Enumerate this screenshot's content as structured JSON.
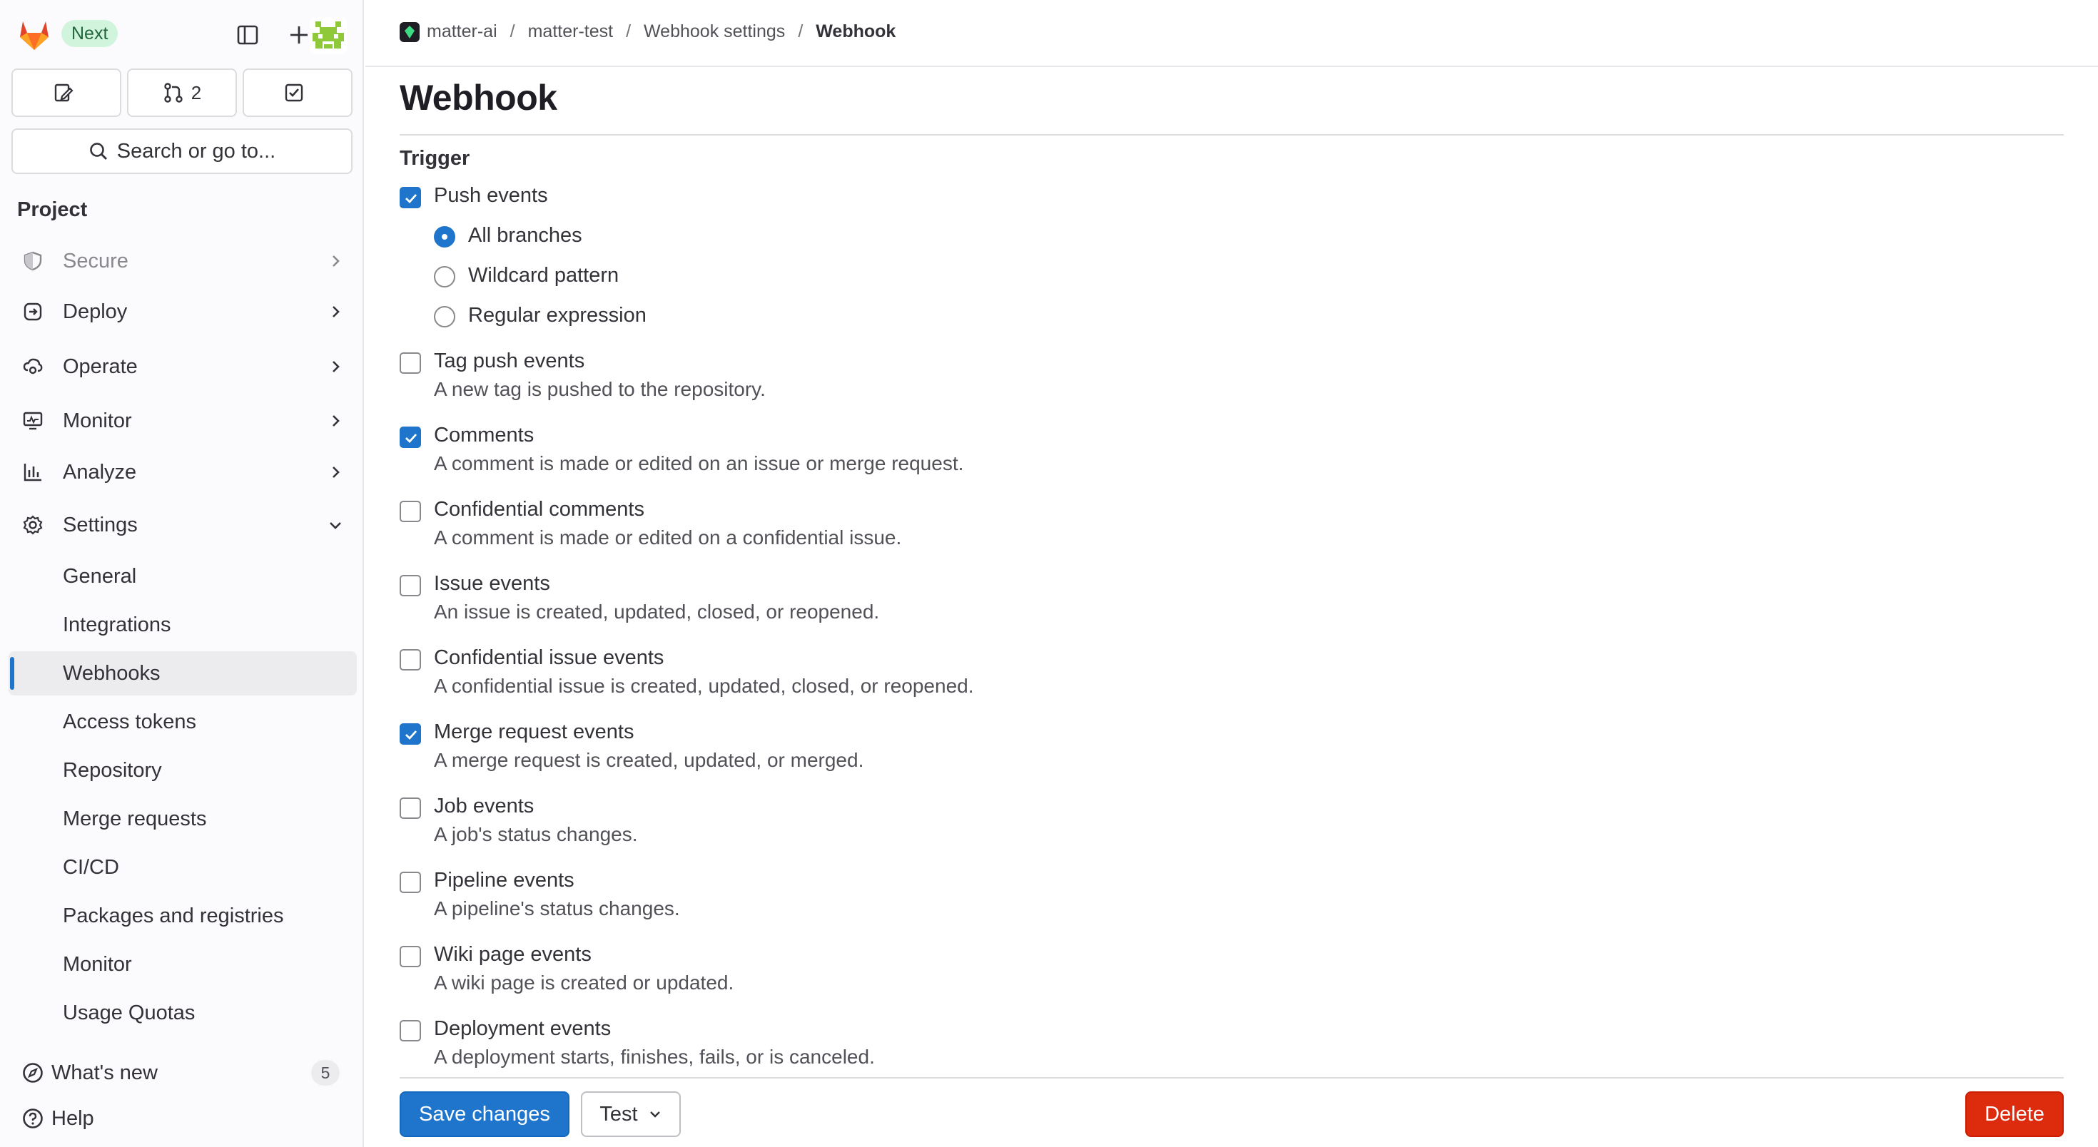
{
  "sidebar": {
    "badge": "Next",
    "counts": {
      "issues": "",
      "merge_requests": "2",
      "todos": ""
    },
    "search_label": "Search or go to...",
    "section_title": "Project",
    "nav": [
      {
        "label": "Secure",
        "icon": "shield-icon"
      },
      {
        "label": "Deploy",
        "icon": "deploy-icon"
      },
      {
        "label": "Operate",
        "icon": "operate-icon"
      },
      {
        "label": "Monitor",
        "icon": "monitor-icon"
      },
      {
        "label": "Analyze",
        "icon": "chart-icon"
      },
      {
        "label": "Settings",
        "icon": "gear-icon"
      }
    ],
    "settings_items": [
      "General",
      "Integrations",
      "Webhooks",
      "Access tokens",
      "Repository",
      "Merge requests",
      "CI/CD",
      "Packages and registries",
      "Monitor",
      "Usage Quotas"
    ],
    "active_item": "Webhooks",
    "whats_new": "What's new",
    "whats_new_count": "5",
    "help": "Help"
  },
  "breadcrumb": [
    "matter-ai",
    "matter-test",
    "Webhook settings",
    "Webhook"
  ],
  "page": {
    "title": "Webhook",
    "trigger_label": "Trigger"
  },
  "push": {
    "label": "Push events",
    "checked": true,
    "options": [
      {
        "label": "All branches",
        "selected": true
      },
      {
        "label": "Wildcard pattern",
        "selected": false
      },
      {
        "label": "Regular expression",
        "selected": false
      }
    ]
  },
  "events": [
    {
      "label": "Tag push events",
      "help": "A new tag is pushed to the repository.",
      "checked": false
    },
    {
      "label": "Comments",
      "help": "A comment is made or edited on an issue or merge request.",
      "checked": true
    },
    {
      "label": "Confidential comments",
      "help": "A comment is made or edited on a confidential issue.",
      "checked": false
    },
    {
      "label": "Issue events",
      "help": "An issue is created, updated, closed, or reopened.",
      "checked": false
    },
    {
      "label": "Confidential issue events",
      "help": "A confidential issue is created, updated, closed, or reopened.",
      "checked": false
    },
    {
      "label": "Merge request events",
      "help": "A merge request is created, updated, or merged.",
      "checked": true
    },
    {
      "label": "Job events",
      "help": "A job's status changes.",
      "checked": false
    },
    {
      "label": "Pipeline events",
      "help": "A pipeline's status changes.",
      "checked": false
    },
    {
      "label": "Wiki page events",
      "help": "A wiki page is created or updated.",
      "checked": false
    },
    {
      "label": "Deployment events",
      "help": "A deployment starts, finishes, fails, or is canceled.",
      "checked": false
    }
  ],
  "footer": {
    "save": "Save changes",
    "test": "Test",
    "delete": "Delete"
  },
  "colors": {
    "primary": "#1f75cb",
    "danger": "#dd2b0e",
    "next_badge_bg": "#d1f4dc"
  }
}
